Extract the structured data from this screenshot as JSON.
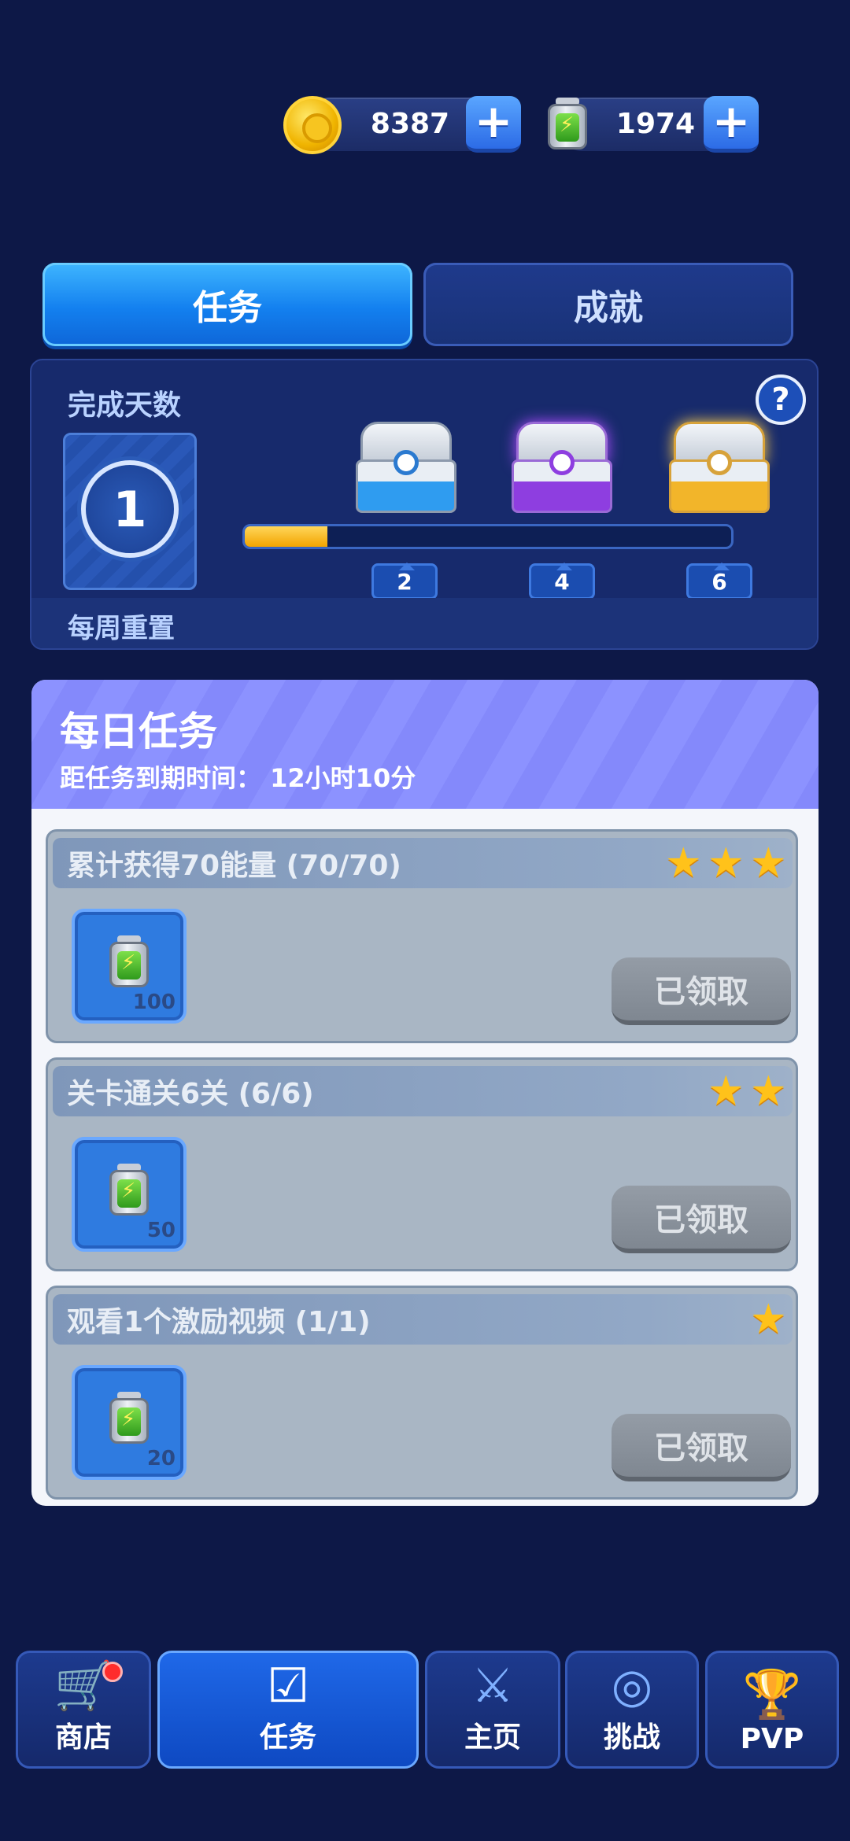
{
  "currency": {
    "coins": "8387",
    "energy": "1974",
    "plus_label": "+"
  },
  "tabs": {
    "tasks": "任务",
    "achievements": "成就"
  },
  "completion": {
    "title": "完成天数",
    "days": "1",
    "reset_text": "每周重置",
    "help_label": "?",
    "progress_fraction": 0.17,
    "milestones": [
      "2",
      "4",
      "6"
    ]
  },
  "daily": {
    "title": "每日任务",
    "subtitle": "距任务到期时间： 12小时10分",
    "tasks": [
      {
        "title": "累计获得70能量 (70/70)",
        "stars": 3,
        "reward": "100",
        "button": "已领取"
      },
      {
        "title": "关卡通关6关 (6/6)",
        "stars": 2,
        "reward": "50",
        "button": "已领取"
      },
      {
        "title": "观看1个激励视频 (1/1)",
        "stars": 1,
        "reward": "20",
        "button": "已领取"
      }
    ]
  },
  "nav": {
    "shop": "商店",
    "tasks": "任务",
    "home": "主页",
    "challenge": "挑战",
    "pvp": "PVP"
  },
  "colors": {
    "background": "#0d1847",
    "accent": "#1380ef",
    "gold": "#ffc21a"
  }
}
